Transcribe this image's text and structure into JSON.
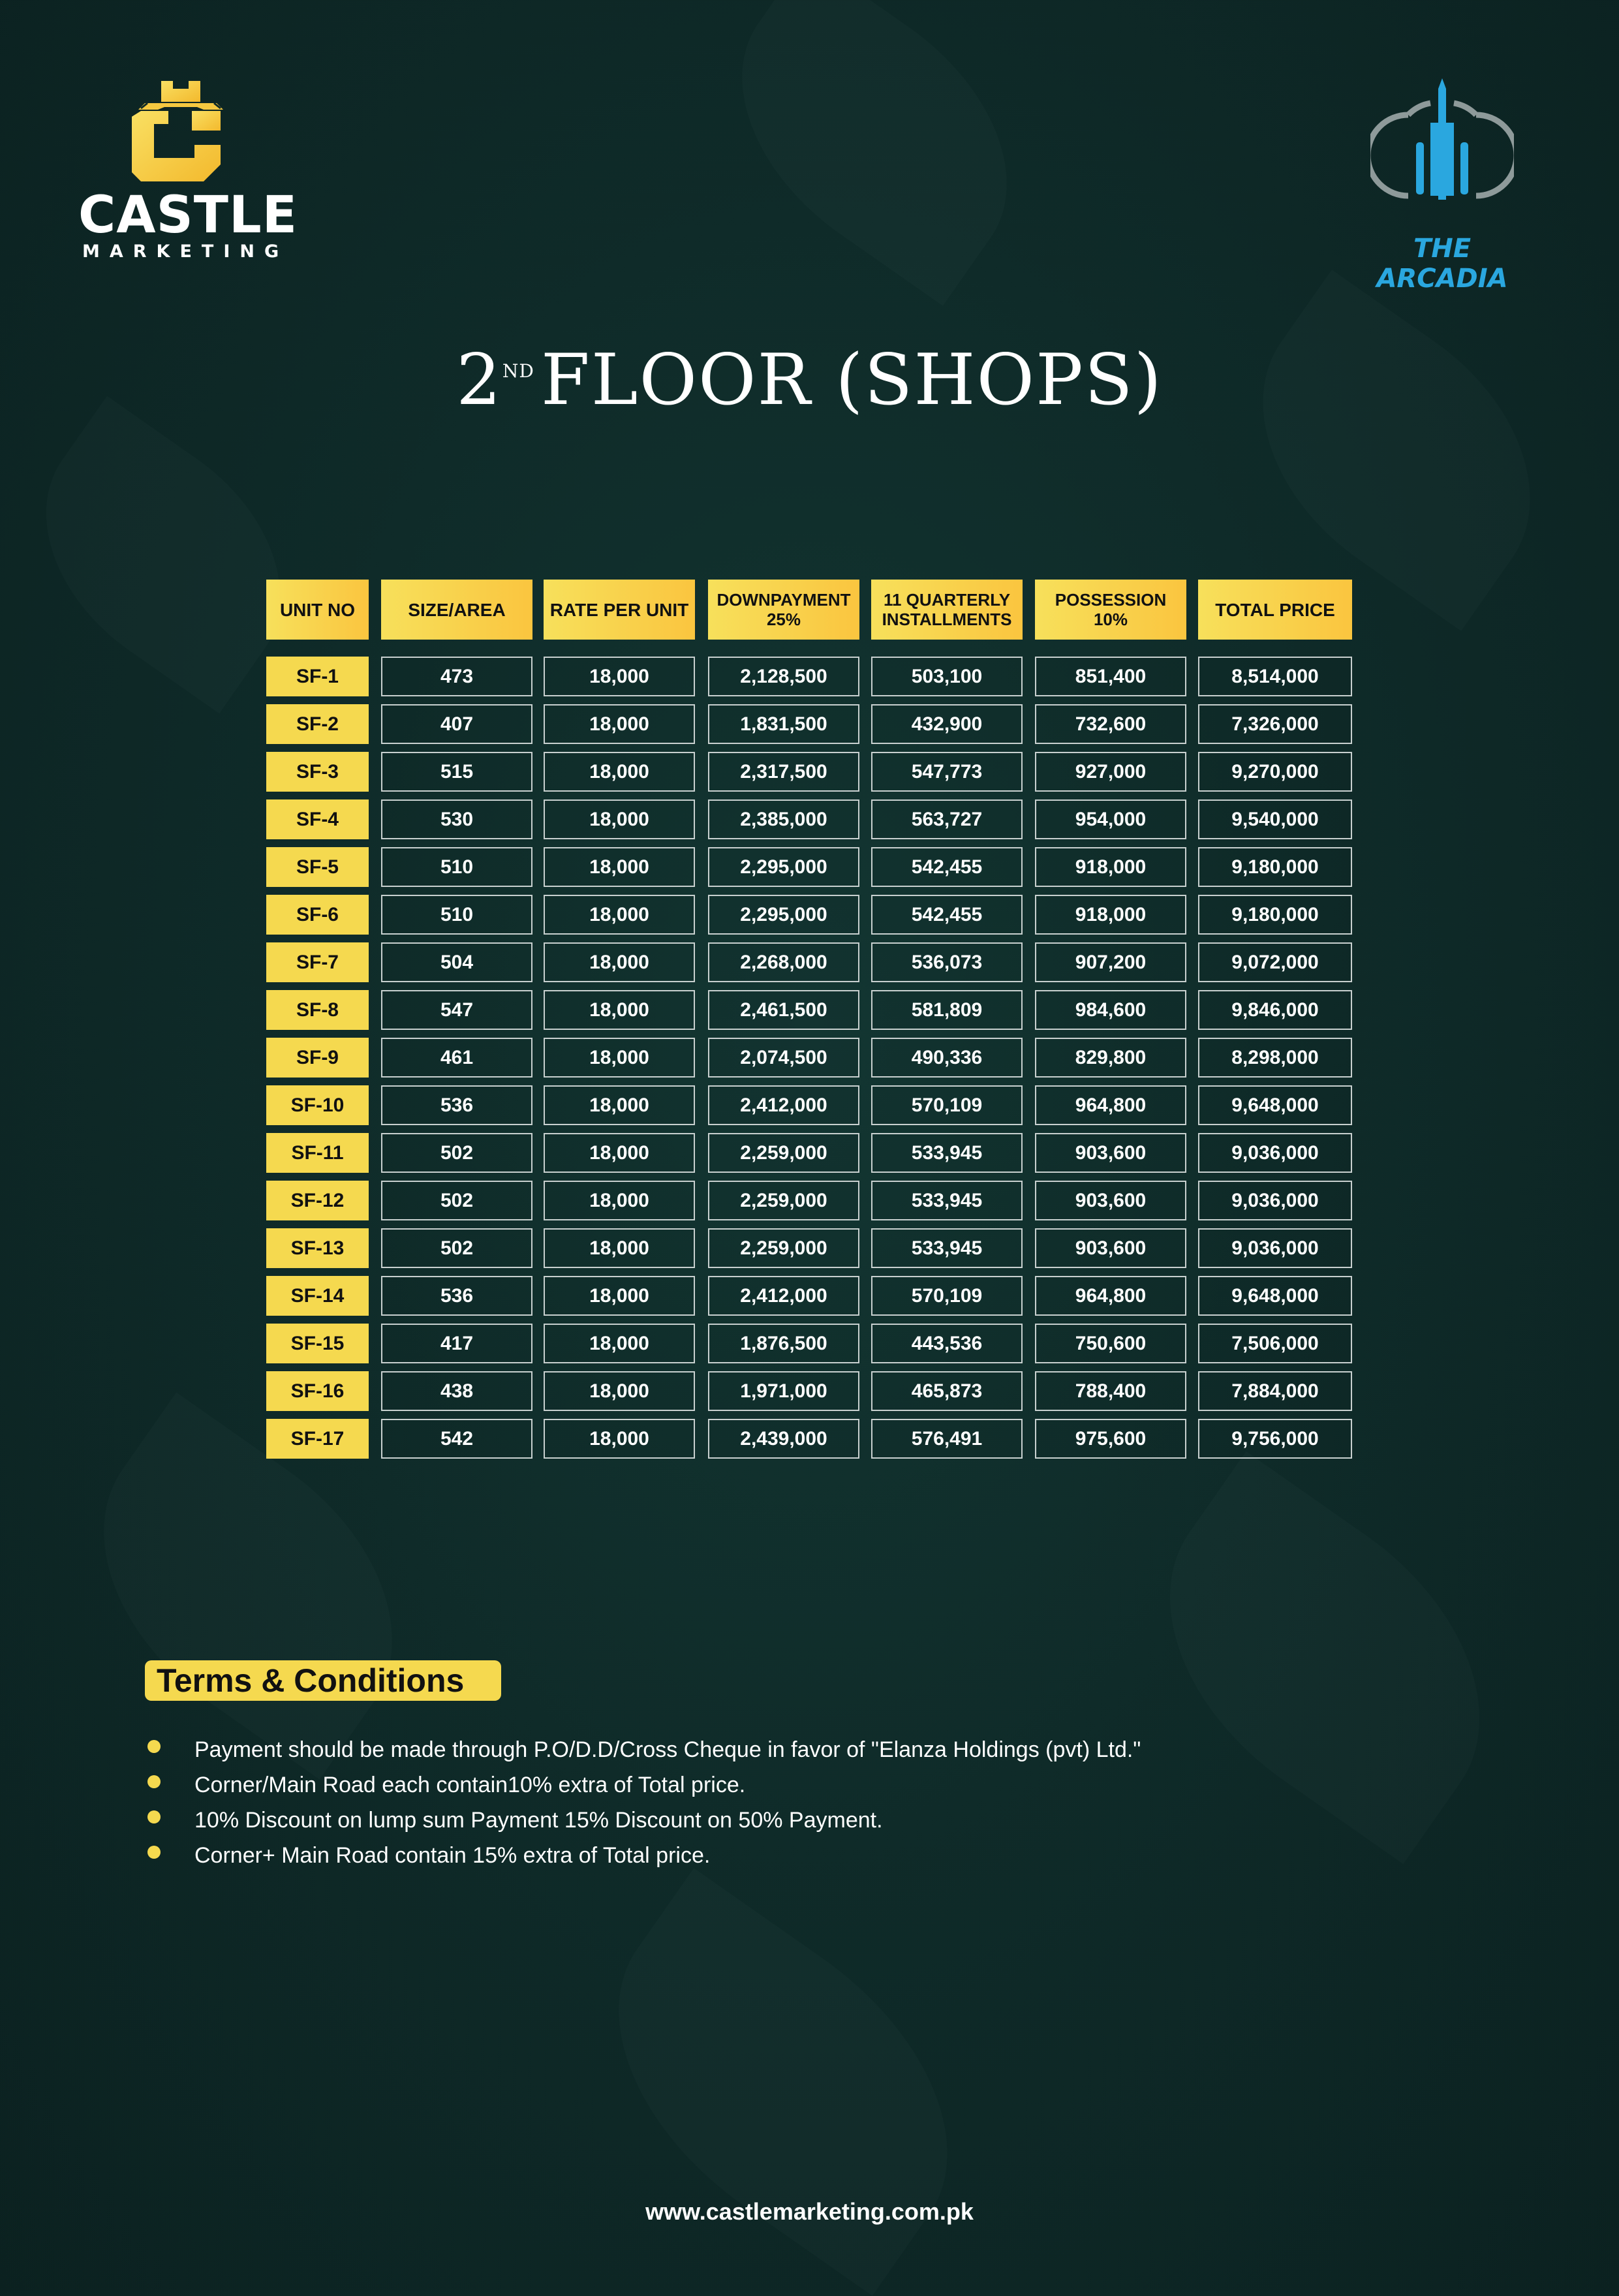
{
  "brand": {
    "castle_word": "CASTLE",
    "castle_sub": "MARKETING",
    "arcadia_word": "THE ARCADIA",
    "colors": {
      "gold": "#f5d94f",
      "arcadia_blue": "#2aa7df",
      "background": "#0f2b29"
    }
  },
  "title": {
    "ordinal": "2",
    "suffix": "ND",
    "text": "FLOOR (SHOPS)"
  },
  "table": {
    "headers": [
      "UNIT NO",
      "SIZE/AREA",
      "RATE PER UNIT",
      "DOWNPAYMENT\n25%",
      "11 QUARTERLY\nINSTALLMENTS",
      "POSSESSION\n10%",
      "TOTAL PRICE"
    ],
    "rows": [
      [
        "SF-1",
        "473",
        "18,000",
        "2,128,500",
        "503,100",
        "851,400",
        "8,514,000"
      ],
      [
        "SF-2",
        "407",
        "18,000",
        "1,831,500",
        "432,900",
        "732,600",
        "7,326,000"
      ],
      [
        "SF-3",
        "515",
        "18,000",
        "2,317,500",
        "547,773",
        "927,000",
        "9,270,000"
      ],
      [
        "SF-4",
        "530",
        "18,000",
        "2,385,000",
        "563,727",
        "954,000",
        "9,540,000"
      ],
      [
        "SF-5",
        "510",
        "18,000",
        "2,295,000",
        "542,455",
        "918,000",
        "9,180,000"
      ],
      [
        "SF-6",
        "510",
        "18,000",
        "2,295,000",
        "542,455",
        "918,000",
        "9,180,000"
      ],
      [
        "SF-7",
        "504",
        "18,000",
        "2,268,000",
        "536,073",
        "907,200",
        "9,072,000"
      ],
      [
        "SF-8",
        "547",
        "18,000",
        "2,461,500",
        "581,809",
        "984,600",
        "9,846,000"
      ],
      [
        "SF-9",
        "461",
        "18,000",
        "2,074,500",
        "490,336",
        "829,800",
        "8,298,000"
      ],
      [
        "SF-10",
        "536",
        "18,000",
        "2,412,000",
        "570,109",
        "964,800",
        "9,648,000"
      ],
      [
        "SF-11",
        "502",
        "18,000",
        "2,259,000",
        "533,945",
        "903,600",
        "9,036,000"
      ],
      [
        "SF-12",
        "502",
        "18,000",
        "2,259,000",
        "533,945",
        "903,600",
        "9,036,000"
      ],
      [
        "SF-13",
        "502",
        "18,000",
        "2,259,000",
        "533,945",
        "903,600",
        "9,036,000"
      ],
      [
        "SF-14",
        "536",
        "18,000",
        "2,412,000",
        "570,109",
        "964,800",
        "9,648,000"
      ],
      [
        "SF-15",
        "417",
        "18,000",
        "1,876,500",
        "443,536",
        "750,600",
        "7,506,000"
      ],
      [
        "SF-16",
        "438",
        "18,000",
        "1,971,000",
        "465,873",
        "788,400",
        "7,884,000"
      ],
      [
        "SF-17",
        "542",
        "18,000",
        "2,439,000",
        "576,491",
        "975,600",
        "9,756,000"
      ]
    ]
  },
  "terms": {
    "heading": "Terms & Conditions",
    "items": [
      "Payment should be made through P.O/D.D/Cross Cheque in favor of \"Elanza Holdings (pvt) Ltd.\"",
      "Corner/Main Road each contain10% extra of Total price.",
      "10% Discount on lump sum Payment 15% Discount on 50% Payment.",
      "Corner+ Main Road contain 15% extra of Total price."
    ]
  },
  "footer": {
    "url": "www.castlemarketing.com.pk"
  }
}
